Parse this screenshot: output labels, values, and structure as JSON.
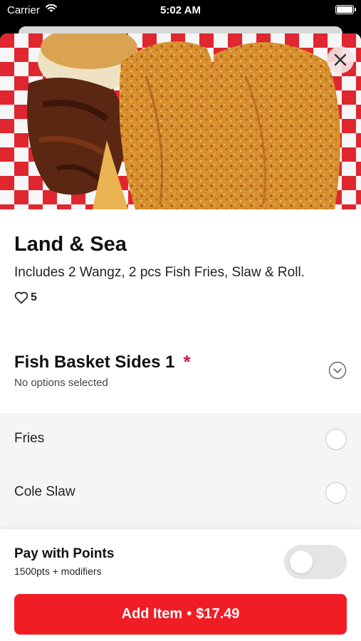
{
  "status_bar": {
    "carrier": "Carrier",
    "time": "5:02 AM"
  },
  "item": {
    "title": "Land & Sea",
    "description": "Includes 2 Wangz, 2 pcs Fish Fries, Slaw & Roll.",
    "likes": "5"
  },
  "modifier_group": {
    "title": "Fish Basket Sides 1",
    "required_mark": "*",
    "status": "No options selected",
    "options": [
      {
        "label": "Fries",
        "selected": false
      },
      {
        "label": "Cole Slaw",
        "selected": false
      }
    ]
  },
  "points": {
    "title": "Pay with Points",
    "subtitle": "1500pts + modifiers",
    "enabled": false
  },
  "cta": {
    "label": "Add Item",
    "separator": "•",
    "price": "$17.49"
  },
  "colors": {
    "accent": "#f01d25",
    "required": "#c8194f",
    "toggle_off": "#e5e5e5",
    "options_bg": "#f5f5f5"
  },
  "icons": {
    "status": [
      "wifi-icon",
      "battery-icon"
    ],
    "close": "close-icon",
    "likes": "heart-icon",
    "expand": "chevron-down-circle-icon"
  }
}
